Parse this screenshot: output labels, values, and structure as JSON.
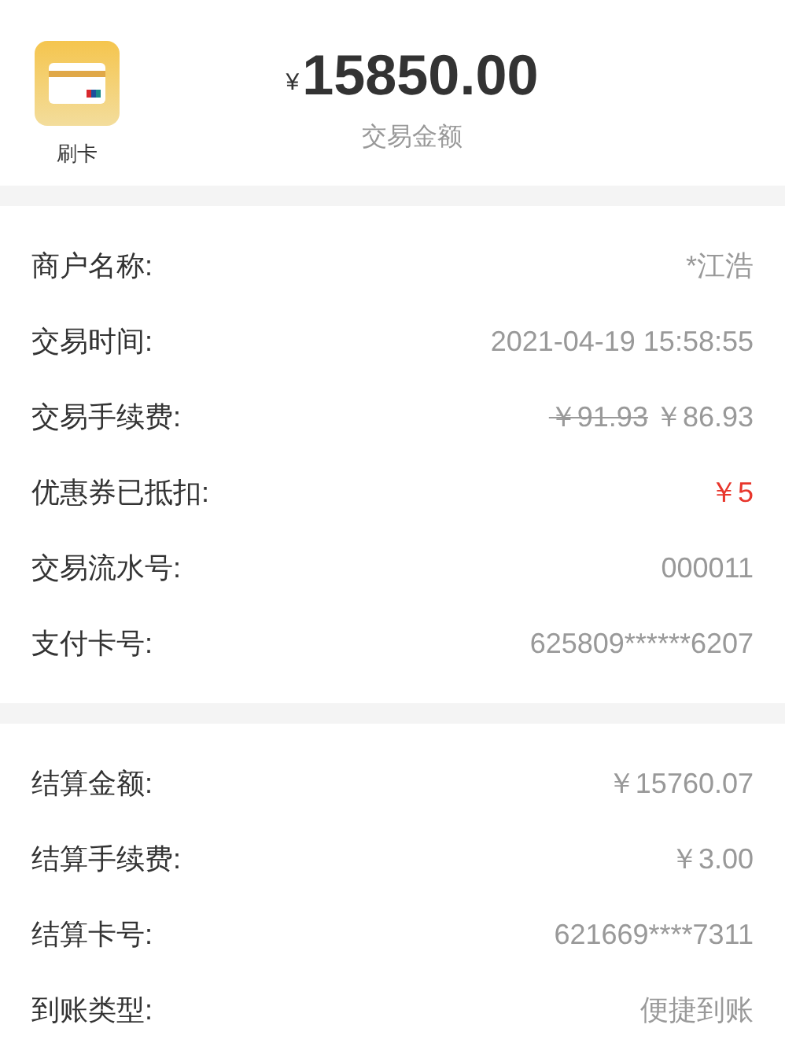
{
  "header": {
    "icon_label": "刷卡",
    "currency": "¥",
    "amount": "15850.00",
    "amount_label": "交易金额"
  },
  "sections": [
    {
      "rows": [
        {
          "kind": "plain",
          "label": "商户名称:",
          "value": "*江浩"
        },
        {
          "kind": "plain",
          "label": "交易时间:",
          "value": "2021-04-19 15:58:55"
        },
        {
          "kind": "discounted",
          "label": "交易手续费:",
          "old_value": "￥91.93",
          "value": "￥86.93"
        },
        {
          "kind": "highlight",
          "label": "优惠券已抵扣:",
          "value": "￥5"
        },
        {
          "kind": "plain",
          "label": "交易流水号:",
          "value": "000011"
        },
        {
          "kind": "plain",
          "label": "支付卡号:",
          "value": "625809******6207"
        }
      ]
    },
    {
      "rows": [
        {
          "kind": "plain",
          "label": "结算金额:",
          "value": "￥15760.07"
        },
        {
          "kind": "plain",
          "label": "结算手续费:",
          "value": "￥3.00"
        },
        {
          "kind": "plain",
          "label": "结算卡号:",
          "value": "621669****7311"
        },
        {
          "kind": "plain",
          "label": "到账类型:",
          "value": "便捷到账"
        }
      ]
    }
  ]
}
